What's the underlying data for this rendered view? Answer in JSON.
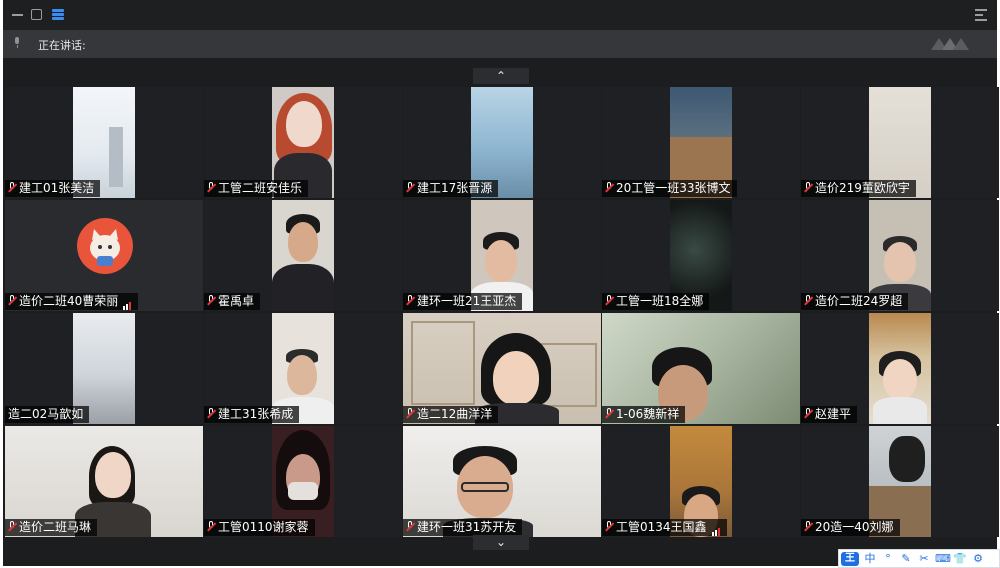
{
  "speaking": {
    "label": "正在讲话:"
  },
  "nav": {
    "up": "⌃",
    "down": "⌄"
  },
  "ime": {
    "logo": "王",
    "mode": "中",
    "items": [
      "°",
      "✎",
      "✂",
      "⌨",
      "👕",
      "⚙"
    ]
  },
  "participants": [
    {
      "name": "建工01张美洁",
      "muted": true,
      "signal": false
    },
    {
      "name": "工管二班安佳乐",
      "muted": true,
      "signal": false
    },
    {
      "name": "建工17张晋源",
      "muted": true,
      "signal": false
    },
    {
      "name": "20工管一班33张博文",
      "muted": true,
      "signal": false
    },
    {
      "name": "造价219董欧欣宇",
      "muted": true,
      "signal": false
    },
    {
      "name": "造价二班40曹荣丽",
      "muted": true,
      "signal": true
    },
    {
      "name": "霍禹卓",
      "muted": true,
      "signal": false
    },
    {
      "name": "建环一班21王亚杰",
      "muted": true,
      "signal": false
    },
    {
      "name": "工管一班18全娜",
      "muted": true,
      "signal": false
    },
    {
      "name": "造价二班24罗超",
      "muted": true,
      "signal": false
    },
    {
      "name": "造二02马歆如",
      "muted": false,
      "signal": false
    },
    {
      "name": "建工31张希成",
      "muted": true,
      "signal": false
    },
    {
      "name": "造二12曲洋洋",
      "muted": true,
      "signal": false
    },
    {
      "name": "1-06魏新祥",
      "muted": true,
      "signal": false
    },
    {
      "name": "赵建平",
      "muted": true,
      "signal": false
    },
    {
      "name": "造价二班马琳",
      "muted": true,
      "signal": false
    },
    {
      "name": "工管0110谢家蓉",
      "muted": true,
      "signal": false
    },
    {
      "name": "建环一班31苏开友",
      "muted": true,
      "signal": false
    },
    {
      "name": "工管0134王国鑫",
      "muted": true,
      "signal": true
    },
    {
      "name": "20造一40刘娜",
      "muted": true,
      "signal": false
    }
  ]
}
